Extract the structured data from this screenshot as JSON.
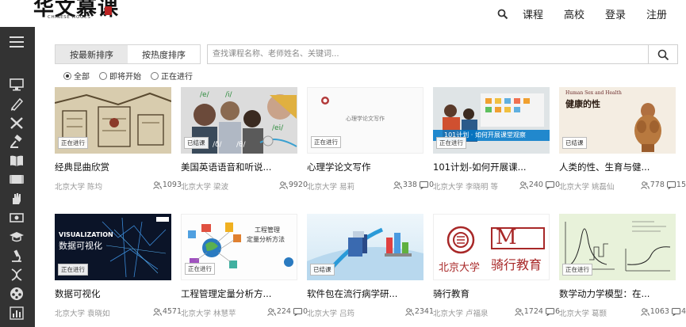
{
  "header": {
    "logo_main": "华文慕课",
    "logo_sub": "CHINESE MOOCS",
    "nav": [
      "课程",
      "高校",
      "登录",
      "注册"
    ]
  },
  "toolbar": {
    "sort_latest": "按最新排序",
    "sort_hot": "按热度排序",
    "search_placeholder": "查找课程名称、老师姓名、关键词..."
  },
  "filters": [
    "全部",
    "即将开始",
    "正在进行"
  ],
  "courses": [
    {
      "title": "经典昆曲欣赏",
      "meta": "北京大学 陈均",
      "students": "1093",
      "comments": "",
      "status": "正在进行"
    },
    {
      "title": "美国英语语音和听说...",
      "meta": "北京大学 梁波",
      "students": "9920",
      "comments": "",
      "status": "已结课"
    },
    {
      "title": "心理学论文写作",
      "meta": "北京大学 易莉",
      "students": "338",
      "comments": "0",
      "status": "正在进行",
      "img_text": "心理学论文写作"
    },
    {
      "title": "101计划-如何开展课...",
      "meta": "北京大学 李晓明 等",
      "students": "240",
      "comments": "0",
      "status": "正在进行",
      "img_text": "101计划 · 如何开展课堂观察"
    },
    {
      "title": "人类的性、生育与健...",
      "meta": "北京大学 姚磊仙",
      "students": "778",
      "comments": "15",
      "status": "已结课",
      "img_text_en": "Human Sex and Health",
      "img_text_cn": "健康的性"
    },
    {
      "title": "数据可视化",
      "meta": "北京大学 袁晓如",
      "students": "4571",
      "comments": "",
      "status": "正在进行",
      "img_text_en": "VISUALIZATION",
      "img_text_cn": "数据可视化"
    },
    {
      "title": "工程管理定量分析方...",
      "meta": "北京大学 林慧苹",
      "students": "224",
      "comments": "0",
      "status": "正在进行",
      "img_text_1": "工程管理",
      "img_text_2": "定量分析方法"
    },
    {
      "title": "软件包在流行病学研...",
      "meta": "北京大学 吕筠",
      "students": "2341",
      "comments": "",
      "status": "已结课"
    },
    {
      "title": "骑行教育",
      "meta": "北京大学 卢福泉",
      "students": "1724",
      "comments": "6",
      "status": "",
      "img_text_en": "M",
      "img_text_cn": "骑行教育",
      "img_text_pku": "北京大学"
    },
    {
      "title": "数学动力学模型：在...",
      "meta": "北京大学 葛颢",
      "students": "1063",
      "comments": "4",
      "status": "正在进行"
    }
  ]
}
